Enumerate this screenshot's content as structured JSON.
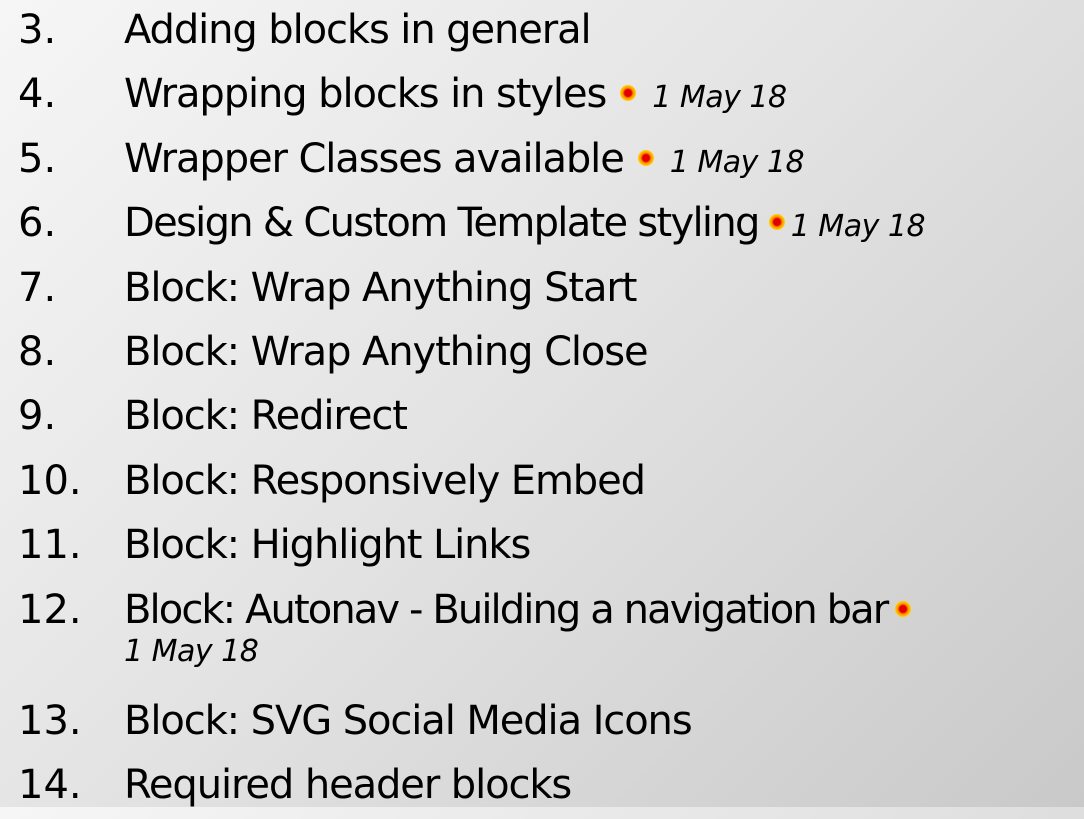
{
  "items": [
    {
      "number": "3.",
      "text": "Adding blocks in general"
    },
    {
      "number": "4.",
      "text": "Wrapping blocks in styles",
      "marker": "new-dot-icon",
      "date": "1 May 18"
    },
    {
      "number": "5.",
      "text": "Wrapper Classes available",
      "marker": "new-dot-icon",
      "date": "1 May 18"
    },
    {
      "number": "6.",
      "text": "Design & Custom Template styling",
      "marker": "new-dot-icon",
      "date": "1 May 18"
    },
    {
      "number": "7.",
      "text": "Block: Wrap Anything Start"
    },
    {
      "number": "8.",
      "text": "Block: Wrap Anything Close"
    },
    {
      "number": "9.",
      "text": "Block: Redirect"
    },
    {
      "number": "10.",
      "text": "Block: Responsively Embed"
    },
    {
      "number": "11.",
      "text": "Block: Highlight Links"
    },
    {
      "number": "12.",
      "text": "Block: Autonav - Building a navigation bar",
      "marker": "new-dot-icon",
      "date": "1 May 18"
    },
    {
      "number": "13.",
      "text": "Block: SVG Social Media Icons"
    },
    {
      "number": "14.",
      "text": "Required header blocks"
    }
  ],
  "colors": {
    "text": "#000000",
    "marker_core": "#e10000",
    "marker_glow": "#fff200"
  }
}
